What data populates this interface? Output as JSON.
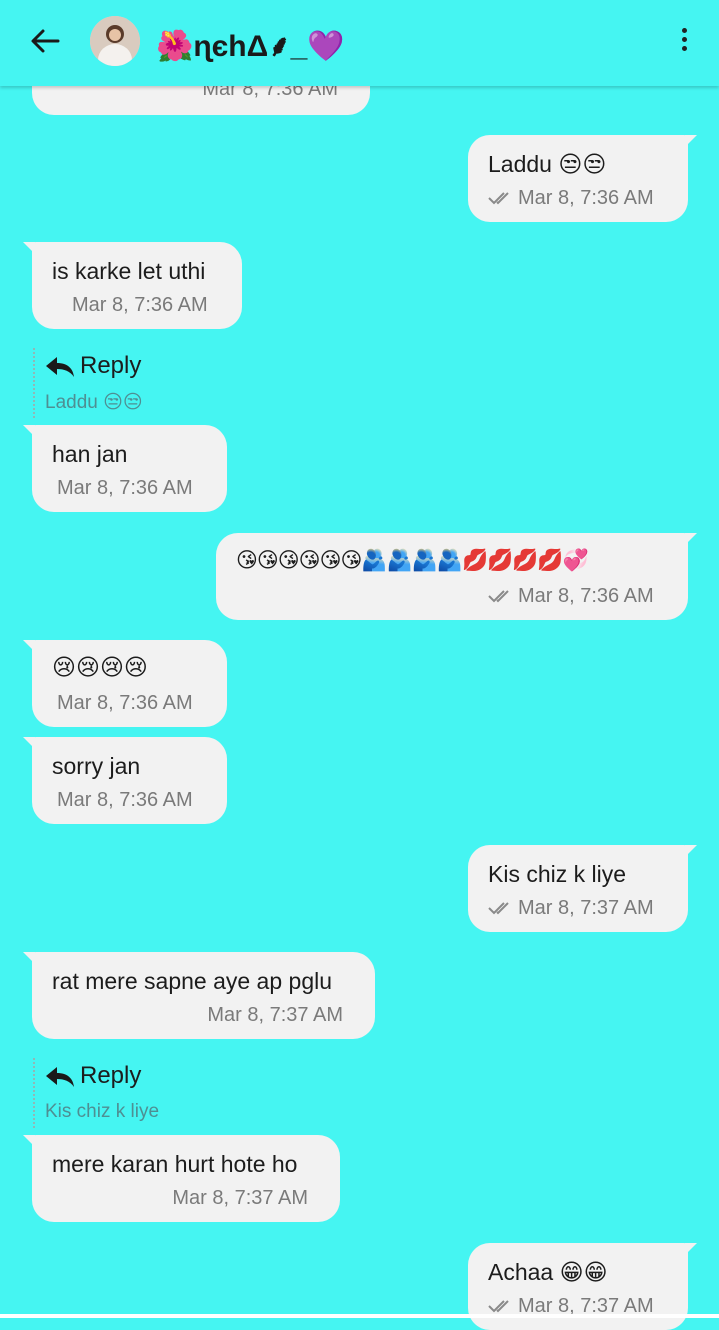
{
  "header": {
    "contact_name": "🌺ɳєhΔ⸙_💜",
    "back_icon": "arrow-left-icon",
    "menu_icon": "more-vertical-icon"
  },
  "messages": [
    {
      "dir": "in",
      "text": "",
      "time": "Mar 8, 7:36 AM"
    },
    {
      "dir": "out",
      "text": "Laddu 😒😒",
      "time": "Mar 8, 7:36 AM"
    },
    {
      "dir": "in",
      "text": "is karke let uthi",
      "time": "Mar 8, 7:36 AM"
    },
    {
      "dir": "in",
      "text": "han jan",
      "time": "Mar 8, 7:36 AM",
      "reply_label": "Reply",
      "reply_quote": "Laddu 😒😒"
    },
    {
      "dir": "out",
      "text": "😘😘😘😘😘😘🫂🫂🫂🫂💋💋💋💋💞",
      "time": "Mar 8, 7:36 AM"
    },
    {
      "dir": "in",
      "text": "😢😢😢😢",
      "time": "Mar 8, 7:36 AM"
    },
    {
      "dir": "in",
      "text": "sorry jan",
      "time": "Mar 8, 7:36 AM"
    },
    {
      "dir": "out",
      "text": "Kis chiz k liye",
      "time": "Mar 8, 7:37 AM"
    },
    {
      "dir": "in",
      "text": "rat mere sapne aye ap pglu",
      "time": "Mar 8, 7:37 AM"
    },
    {
      "dir": "in",
      "text": "mere karan hurt hote ho",
      "time": "Mar 8, 7:37 AM",
      "reply_label": "Reply",
      "reply_quote": "Kis chiz k liye"
    },
    {
      "dir": "out",
      "text": "Achaa 😁😁",
      "time": "Mar 8, 7:37 AM"
    }
  ],
  "colors": {
    "background": "#45F5F2",
    "bubble": "#F2F2F2",
    "reply_quote": "#4e8f93"
  }
}
